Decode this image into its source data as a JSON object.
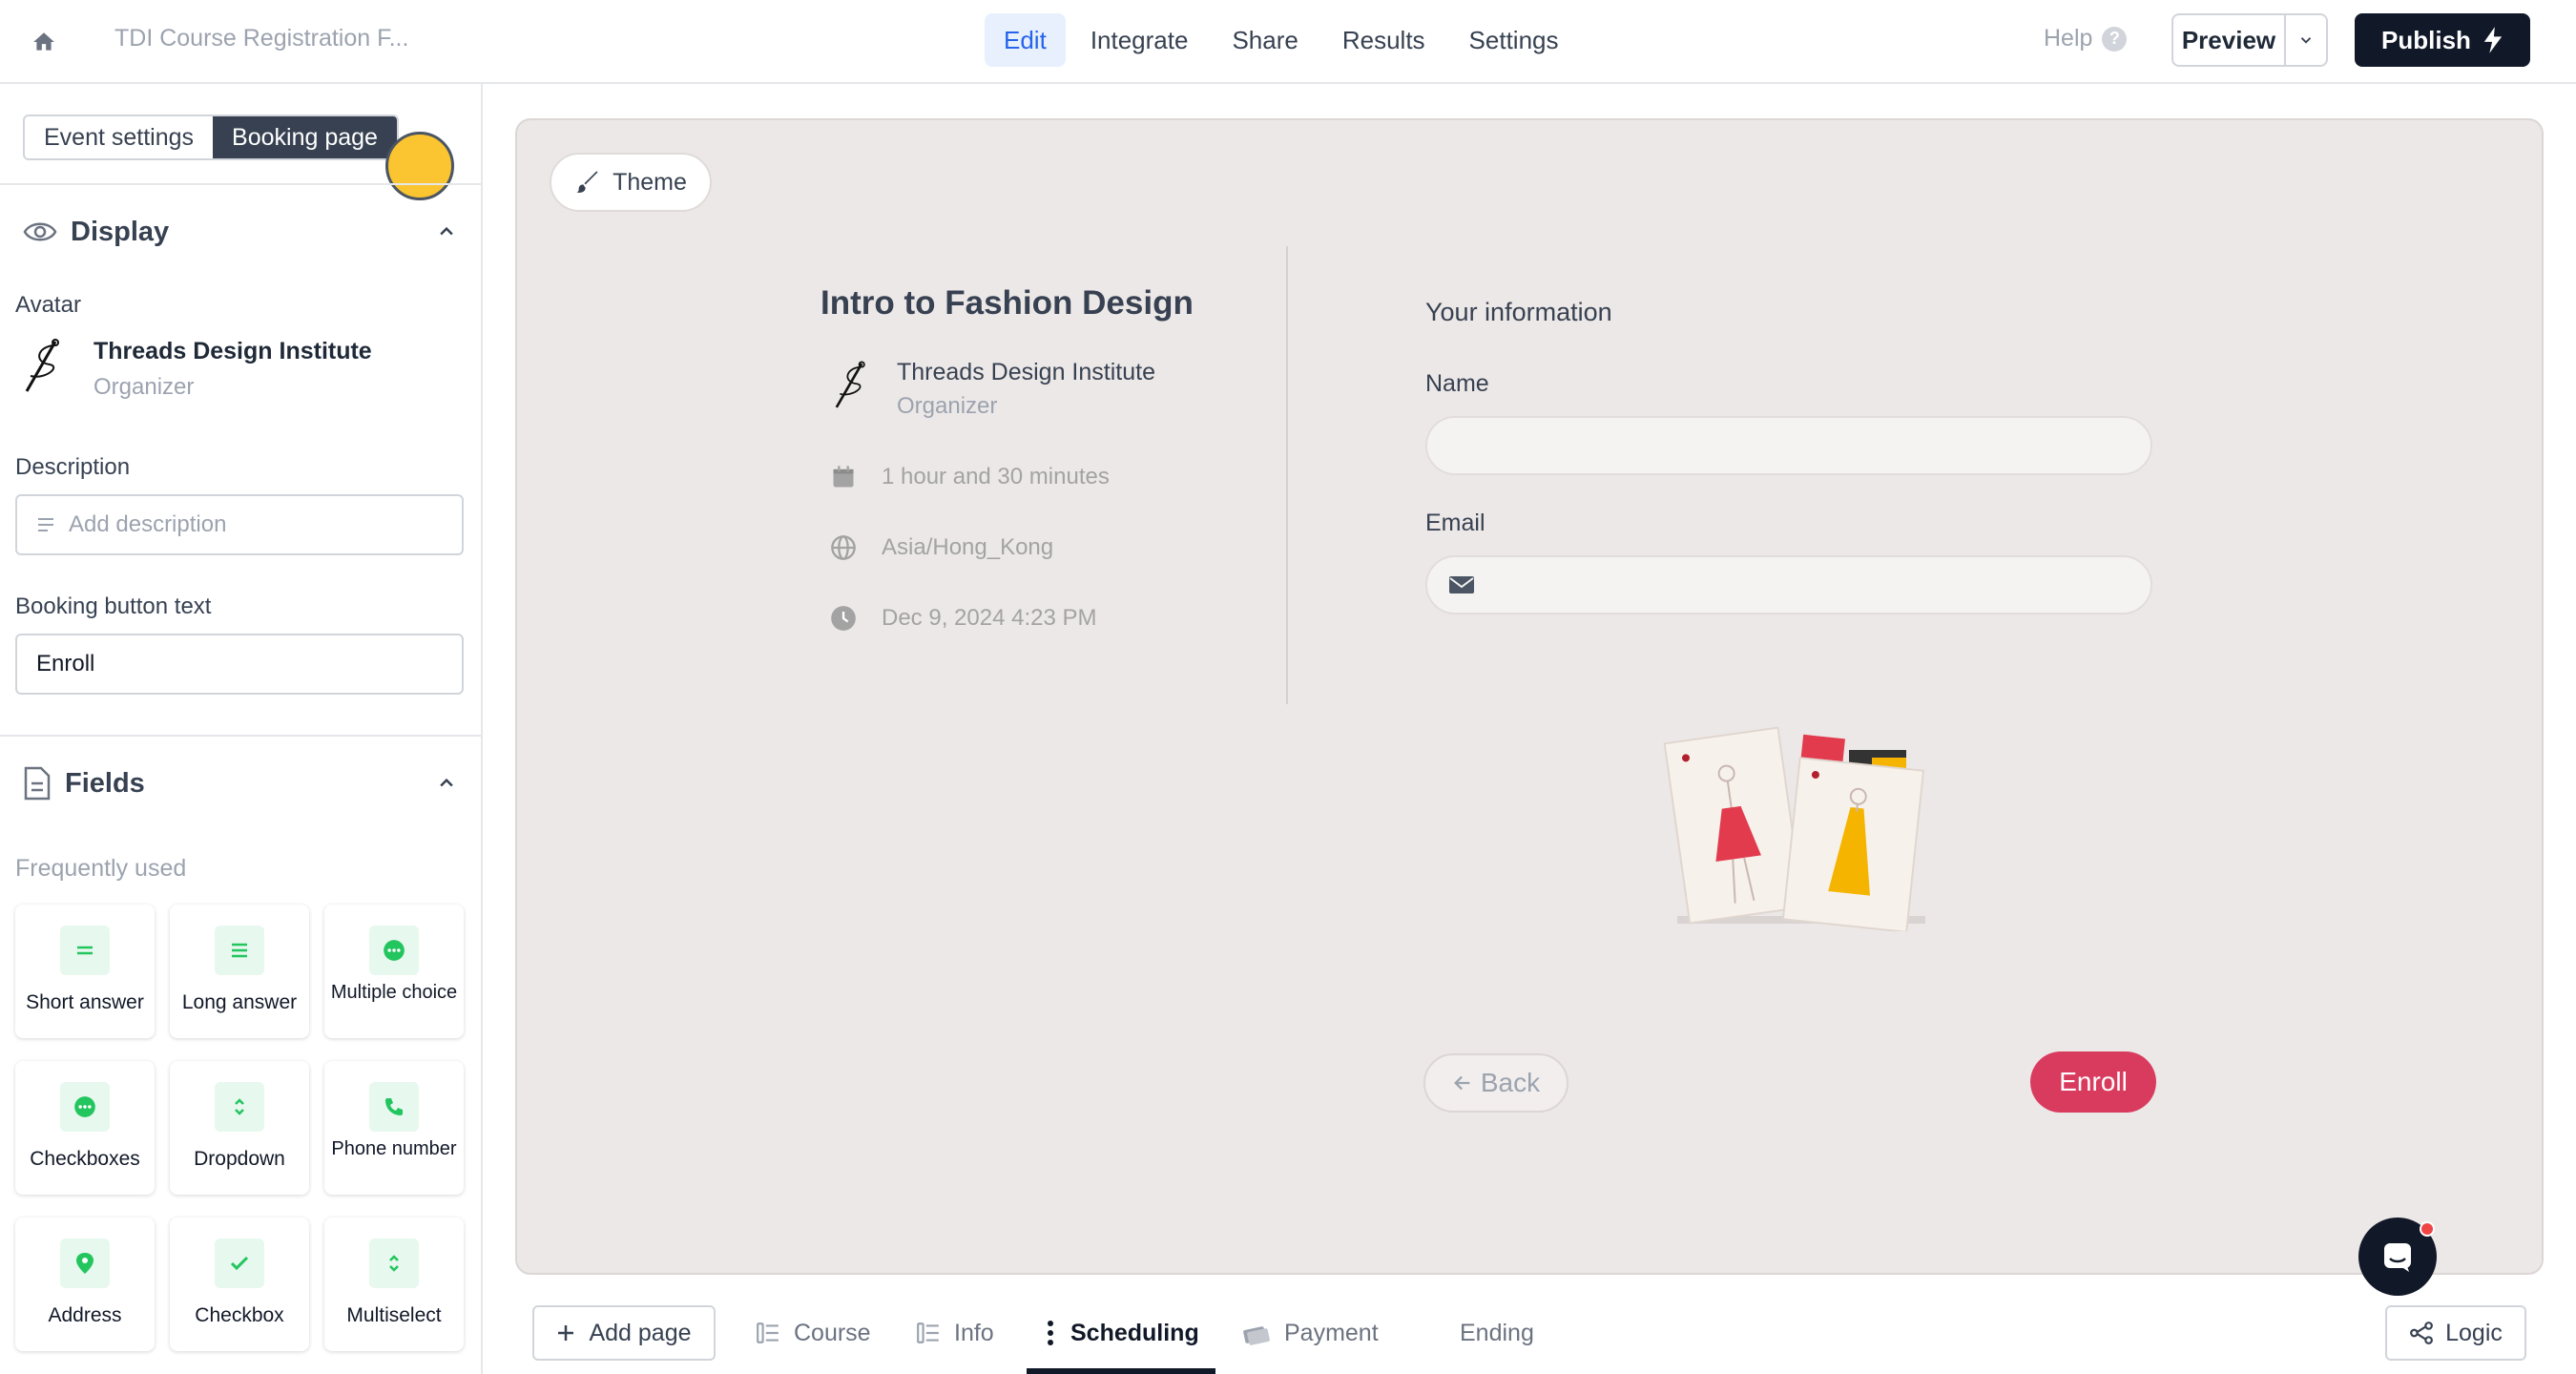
{
  "topbar": {
    "form_title": "TDI Course Registration F...",
    "nav": [
      "Edit",
      "Integrate",
      "Share",
      "Results",
      "Settings"
    ],
    "active_nav": "Edit",
    "help_label": "Help",
    "preview_label": "Preview",
    "publish_label": "Publish"
  },
  "sidebar": {
    "tabs": [
      "Event settings",
      "Booking page"
    ],
    "active_tab": "Booking page",
    "display": {
      "title": "Display",
      "avatar_label": "Avatar",
      "org_name": "Threads Design Institute",
      "org_role": "Organizer",
      "description_label": "Description",
      "description_placeholder": "Add description",
      "button_text_label": "Booking button text",
      "button_text_value": "Enroll"
    },
    "fields": {
      "title": "Fields",
      "frequently_used_label": "Frequently used",
      "items": [
        {
          "label": "Short answer",
          "icon": "short-answer-icon"
        },
        {
          "label": "Long answer",
          "icon": "long-answer-icon"
        },
        {
          "label": "Multiple choice",
          "icon": "multiple-choice-icon"
        },
        {
          "label": "Checkboxes",
          "icon": "checkboxes-icon"
        },
        {
          "label": "Dropdown",
          "icon": "dropdown-icon"
        },
        {
          "label": "Phone number",
          "icon": "phone-icon"
        },
        {
          "label": "Address",
          "icon": "location-pin-icon"
        },
        {
          "label": "Checkbox",
          "icon": "checkmark-icon"
        },
        {
          "label": "Multiselect",
          "icon": "multiselect-icon"
        }
      ]
    }
  },
  "canvas": {
    "theme_label": "Theme",
    "event": {
      "title": "Intro to Fashion Design",
      "org_name": "Threads Design Institute",
      "org_role": "Organizer",
      "duration": "1 hour and 30 minutes",
      "timezone": "Asia/Hong_Kong",
      "datetime": "Dec 9, 2024 4:23 PM"
    },
    "form": {
      "heading": "Your information",
      "name_label": "Name",
      "email_label": "Email"
    },
    "back_label": "Back",
    "enroll_label": "Enroll"
  },
  "bottom": {
    "add_page_label": "Add page",
    "pages": [
      "Course",
      "Info",
      "Scheduling",
      "Payment",
      "Ending"
    ],
    "active_page": "Scheduling",
    "logic_label": "Logic"
  },
  "colors": {
    "accent": "#2563eb",
    "enroll": "#d93b5e",
    "canvas_bg": "#ece8e7",
    "field_icon_green": "#22c55e"
  }
}
